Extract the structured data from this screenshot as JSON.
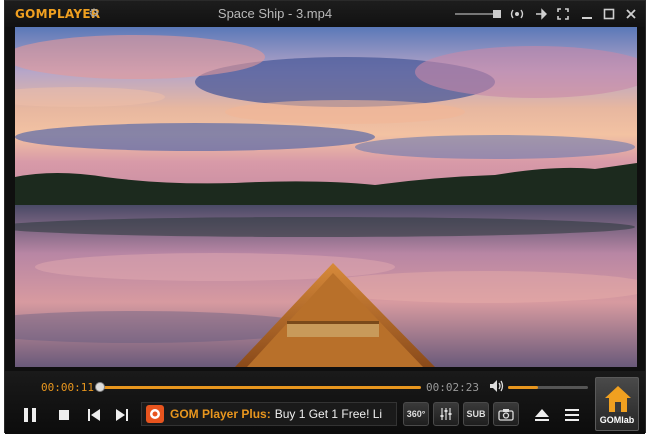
{
  "app": {
    "logo": "GOMPLAYER",
    "window_title": "Space Ship - 3.mp4"
  },
  "titlebar": {
    "volume_level": 0.85,
    "buttons": [
      "surround-icon",
      "pin-icon",
      "fullscreen-icon",
      "minimize-icon",
      "maximize-icon",
      "close-icon"
    ]
  },
  "playback": {
    "current_time": "00:00:11",
    "total_time": "00:02:23",
    "progress": 0.077,
    "volume_level": 0.35
  },
  "controls": {
    "play_pause": "pause-icon",
    "stop": "stop-icon",
    "prev": "previous-icon",
    "next": "next-icon"
  },
  "ad": {
    "brand": "GOM Player Plus:",
    "text": "Buy 1 Get 1 Free! Li"
  },
  "tools": {
    "vr_label": "360°",
    "sub_label": "SUB"
  },
  "gomlab": {
    "label": "GOMlab"
  },
  "colors": {
    "accent": "#e8961e",
    "background": "#0f0f0f"
  }
}
